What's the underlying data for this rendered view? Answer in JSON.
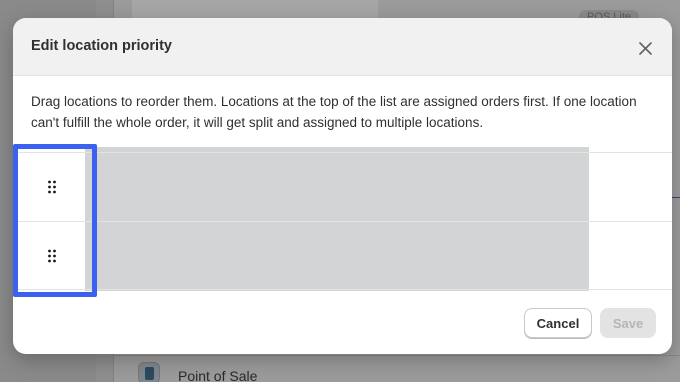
{
  "background": {
    "badge_text": "POS Lite",
    "app_item_label": "Point of Sale"
  },
  "modal": {
    "title": "Edit location priority",
    "close_icon": "close-x-icon",
    "description": "Drag locations to reorder them. Locations at the top of the list are assigned orders first. If one location can't fulfill the whole order, it will get split and assigned to multiple locations.",
    "locations": [
      {
        "handle_icon": "drag-handle-icon",
        "name": ""
      },
      {
        "handle_icon": "drag-handle-icon",
        "name": ""
      }
    ],
    "footer": {
      "cancel_label": "Cancel",
      "save_label": "Save"
    }
  },
  "colors": {
    "highlight": "#3a61ef",
    "overlay_dim": "#8e8e8e",
    "redaction": "#d3d4d6"
  }
}
